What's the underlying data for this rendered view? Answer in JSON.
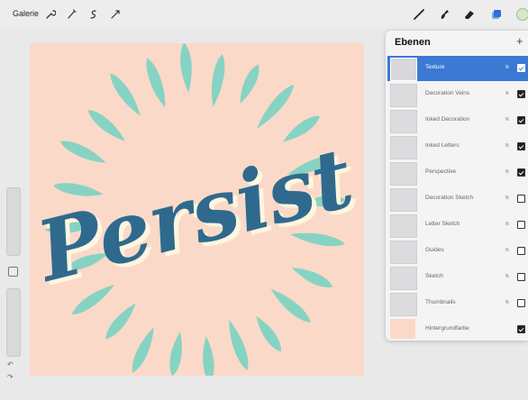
{
  "toolbar": {
    "gallery_label": "Galerie",
    "left_tools": [
      "wrench-icon",
      "magic-wand-icon",
      "selection-icon",
      "transform-icon"
    ],
    "right_tools": [
      "brush-icon",
      "smudge-icon",
      "eraser-icon",
      "layers-icon",
      "color-icon"
    ],
    "accent_color": "#2f6fd6"
  },
  "canvas": {
    "artwork_text": "Persist",
    "background_color": "#fbd9c8",
    "lettering_color": "#2f6a8e",
    "leaf_color": "#86d3c3",
    "shadow_color": "#fff6df"
  },
  "layers_panel": {
    "title": "Ebenen",
    "add_label": "+",
    "layers": [
      {
        "name": "Texture",
        "mode": "N",
        "visible": true,
        "selected": true
      },
      {
        "name": "Decoration Veins",
        "mode": "N",
        "visible": true,
        "selected": false
      },
      {
        "name": "Inked Decoration",
        "mode": "N",
        "visible": true,
        "selected": false
      },
      {
        "name": "Inked Letters",
        "mode": "N",
        "visible": true,
        "selected": false
      },
      {
        "name": "Perspective",
        "mode": "N",
        "visible": true,
        "selected": false
      },
      {
        "name": "Decoration Sketch",
        "mode": "N",
        "visible": false,
        "selected": false
      },
      {
        "name": "Letter Sketch",
        "mode": "N",
        "visible": false,
        "selected": false
      },
      {
        "name": "Guides",
        "mode": "N",
        "visible": false,
        "selected": false
      },
      {
        "name": "Sketch",
        "mode": "N",
        "visible": false,
        "selected": false
      },
      {
        "name": "Thumbnails",
        "mode": "N",
        "visible": false,
        "selected": false
      },
      {
        "name": "Hintergrundfarbe",
        "mode": "",
        "visible": true,
        "selected": false
      }
    ]
  },
  "sidebar": {
    "undo_label": "↶",
    "redo_label": "↷"
  }
}
